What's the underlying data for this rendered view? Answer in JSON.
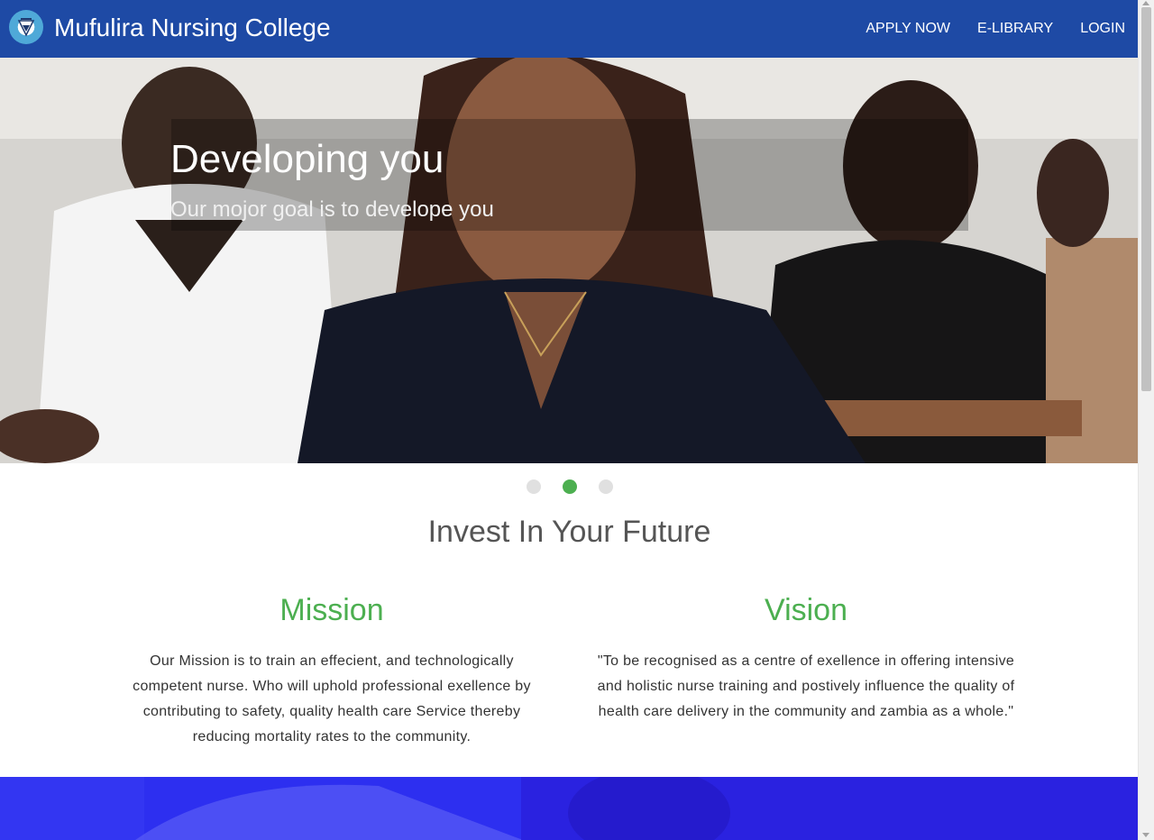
{
  "navbar": {
    "brand": "Mufulira Nursing College",
    "links": [
      "APPLY NOW",
      "E-LIBRARY",
      "LOGIN"
    ]
  },
  "hero": {
    "title": "Developing you",
    "subtitle": "Our mojor goal is to develope you",
    "active_slide": 2,
    "slide_count": 3
  },
  "section": {
    "title": "Invest In Your Future",
    "mission": {
      "heading": "Mission",
      "text": "Our Mission is to train an effecient, and technologically competent nurse. Who will uphold professional exellence by contributing to safety, quality health care Service thereby reducing mortality rates to the community."
    },
    "vision": {
      "heading": "Vision",
      "text": "\"To be recognised as a centre of exellence in offering intensive and holistic nurse training and postively influence the quality of health care delivery in the community and zambia as a whole.\""
    }
  },
  "colors": {
    "navbar": "#1e4aa5",
    "accent": "#4caf50",
    "banner": "#2d2ff0"
  },
  "icons": {
    "logo": "college-crest-icon"
  }
}
